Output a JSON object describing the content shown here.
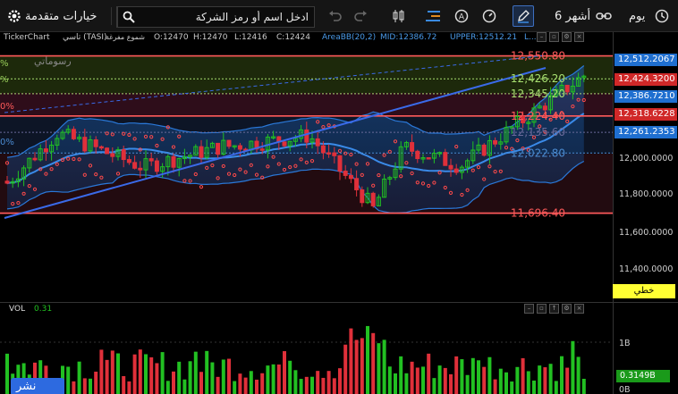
{
  "toolbar": {
    "advanced_options": "خيارات متقدمة",
    "search_placeholder": "ادخل اسم أو رمز الشركة",
    "period": "6 أشهر",
    "interval": "يوم"
  },
  "info": {
    "source": "TickerChart",
    "symbol": "تاسي (TASI)",
    "type": "شموع مفرغة",
    "open": "O:12470",
    "high": "H:12470",
    "low": "L:12416",
    "close": "C:12424",
    "indicator": "AreaBB(20,2)",
    "mid": "MID:12386.72",
    "upper": "UPPER:12512.21",
    "lower": "L..."
  },
  "chart_overlay_label": "رسوماتي",
  "levels": [
    {
      "value": "12,550.80",
      "color": "#ff5a5a"
    },
    {
      "value": "12,426.20",
      "color": "#a8e070"
    },
    {
      "value": "12,345.20",
      "color": "#a8e070"
    },
    {
      "value": "12,224.40",
      "color": "#ff5a5a"
    },
    {
      "value": "12,135.60",
      "color": "#6a6a9a"
    },
    {
      "value": "12,022.80",
      "color": "#4a8ad0"
    },
    {
      "value": "11,696.40",
      "color": "#ff5a5a"
    }
  ],
  "price_axis": {
    "ticks": [
      "12,000.0000",
      "11,800.0000",
      "11,600.0000",
      "11,400.0000"
    ],
    "tags": [
      {
        "text": "12,512.2067",
        "bg": "#1f6fd0"
      },
      {
        "text": "12,424.3200",
        "bg": "#d02828"
      },
      {
        "text": "12,386.7210",
        "bg": "#1f6fd0"
      },
      {
        "text": "12,318.6228",
        "bg": "#d02828"
      },
      {
        "text": "12,261.2353",
        "bg": "#1f6fd0"
      }
    ],
    "scale_type": "خطي"
  },
  "left_pct": [
    "%",
    "%",
    "0%",
    "0%"
  ],
  "volume": {
    "label": "VOL",
    "value": "0.31",
    "ticks": [
      "1B",
      "0B"
    ],
    "last_tag": "0.3149B"
  },
  "corner_button": "نشر",
  "colors": {
    "up": "#22c022",
    "down": "#e0303a",
    "band": "#2a78d8",
    "accent": "#2d6ae0"
  }
}
